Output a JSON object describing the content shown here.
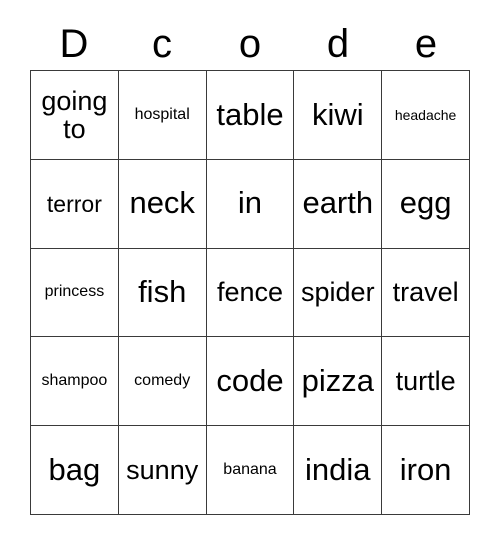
{
  "card": {
    "header": {
      "letters": [
        "D",
        "c",
        "o",
        "d",
        "e"
      ]
    },
    "grid": {
      "rows": 5,
      "columns": 5,
      "border_color": "#3a3a3a",
      "background_color": "#ffffff",
      "text_color": "#000000",
      "cells": [
        [
          {
            "text": "going\nto",
            "size": "lg"
          },
          {
            "text": "hospital",
            "size": "sm"
          },
          {
            "text": "table",
            "size": "xl"
          },
          {
            "text": "kiwi",
            "size": "xl"
          },
          {
            "text": "headache",
            "size": "xs"
          }
        ],
        [
          {
            "text": "terror",
            "size": "md"
          },
          {
            "text": "neck",
            "size": "xl"
          },
          {
            "text": "in",
            "size": "xl"
          },
          {
            "text": "earth",
            "size": "xl"
          },
          {
            "text": "egg",
            "size": "xl"
          }
        ],
        [
          {
            "text": "princess",
            "size": "sm"
          },
          {
            "text": "fish",
            "size": "xl"
          },
          {
            "text": "fence",
            "size": "lg"
          },
          {
            "text": "spider",
            "size": "lg"
          },
          {
            "text": "travel",
            "size": "lg"
          }
        ],
        [
          {
            "text": "shampoo",
            "size": "sm"
          },
          {
            "text": "comedy",
            "size": "sm"
          },
          {
            "text": "code",
            "size": "xl"
          },
          {
            "text": "pizza",
            "size": "xl"
          },
          {
            "text": "turtle",
            "size": "lg"
          }
        ],
        [
          {
            "text": "bag",
            "size": "xl"
          },
          {
            "text": "sunny",
            "size": "lg"
          },
          {
            "text": "banana",
            "size": "sm"
          },
          {
            "text": "india",
            "size": "xl"
          },
          {
            "text": "iron",
            "size": "xl"
          }
        ]
      ]
    }
  }
}
